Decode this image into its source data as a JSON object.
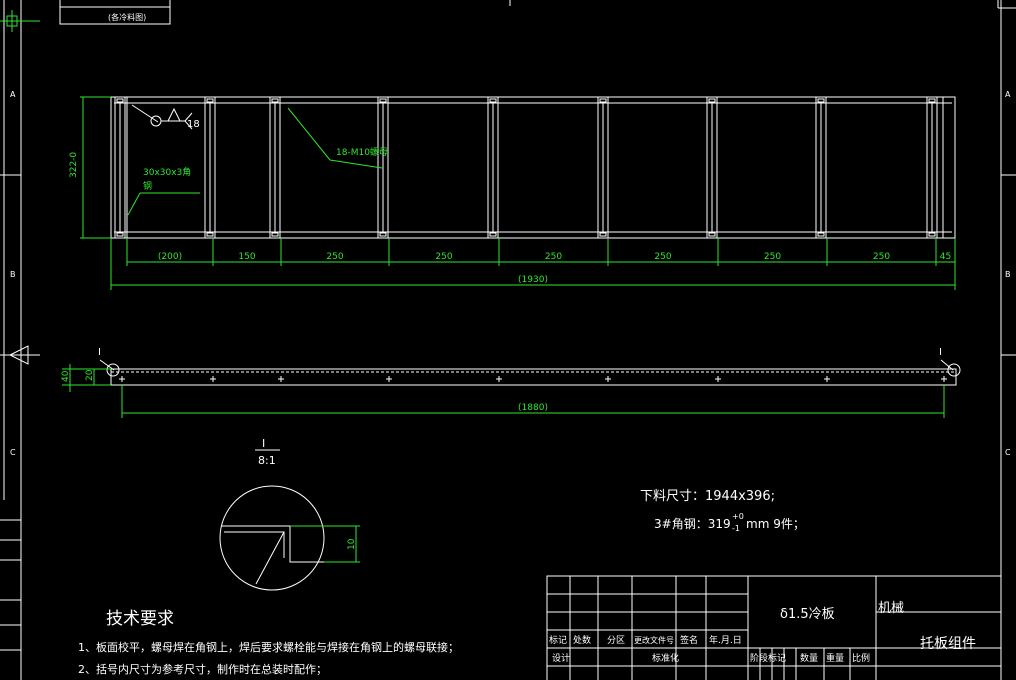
{
  "top_box": {
    "label": "(各冷料图)"
  },
  "zone_letters": [
    "A",
    "B",
    "C"
  ],
  "colors": {
    "line": "#ffffff",
    "dim": "#2ee62e",
    "background": "#000000"
  },
  "front_view": {
    "leader_angle": "30x30x3角\n钢",
    "leader_nut": "18-M10螺母",
    "weld_symbol": "18",
    "height_dim": "322-0",
    "dims": [
      "(200)",
      "150",
      "250",
      "250",
      "250",
      "250",
      "250",
      "250",
      "45"
    ],
    "overall": "(1930)"
  },
  "side_view": {
    "dim_outer": "40",
    "dim_inner": "20",
    "overall": "(1880)",
    "mark_left": "I",
    "mark_right": "I"
  },
  "detail": {
    "mark": "I",
    "scale": "8:1",
    "dim": "10"
  },
  "cut_info": {
    "line1": "下料尺寸：1944x396;",
    "line2_prefix": "3#角钢：319",
    "line2_tol_top": "+0",
    "line2_tol_bot": "-1",
    "line2_suffix": "mm   9件；"
  },
  "tech": {
    "heading": "技术要求",
    "items": [
      "1、板面校平，螺母焊在角钢上，焊后要求螺栓能与焊接在角钢上的螺母联接；",
      "2、括号内尺寸为参考尺寸，制作时在总装时配作；"
    ]
  },
  "title_block": {
    "material": "δ1.5冷板",
    "company": "机械",
    "part_name": "托板组件",
    "headers": [
      "标记",
      "处数",
      "分区",
      "更改文件号",
      "签名",
      "年.月.日"
    ],
    "row2": [
      "设计",
      "标准化"
    ],
    "stage_headers": [
      "阶段标记",
      "数量",
      "重量",
      "比例"
    ]
  }
}
